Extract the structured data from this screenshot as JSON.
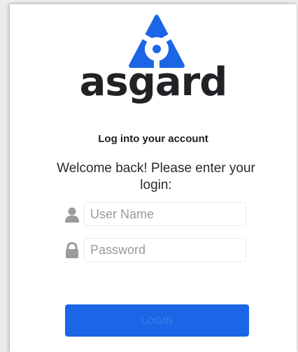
{
  "brand": {
    "name": "asgard",
    "logo_icon": "asgard-logo-icon",
    "logo_color": "#1a66e6",
    "wordmark_color": "#222226"
  },
  "header": {
    "subtitle": "Log into your account",
    "welcome": "Welcome back! Please enter your login:"
  },
  "form": {
    "username": {
      "icon": "user-icon",
      "value": "",
      "placeholder": "User Name"
    },
    "password": {
      "icon": "lock-icon",
      "value": "",
      "placeholder": "Password"
    },
    "login_label": "LOGIN",
    "login_color": "#1a66e6"
  }
}
